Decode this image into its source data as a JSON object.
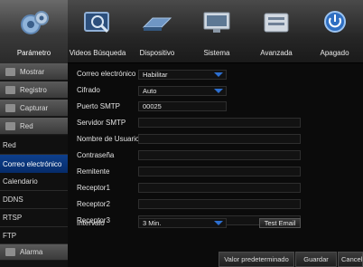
{
  "tabs": [
    {
      "label": "Parámetro",
      "icon": "gears-icon"
    },
    {
      "label": "Videos Búsqueda",
      "icon": "search-video-icon"
    },
    {
      "label": "Dispositivo",
      "icon": "hard-drive-icon"
    },
    {
      "label": "Sistema",
      "icon": "monitor-icon"
    },
    {
      "label": "Avanzada",
      "icon": "advanced-settings-icon"
    },
    {
      "label": "Apagado",
      "icon": "power-icon"
    }
  ],
  "sidebar": {
    "groups": [
      {
        "label": "Mostrar",
        "icon": "display-icon"
      },
      {
        "label": "Registro",
        "icon": "record-icon"
      },
      {
        "label": "Capturar",
        "icon": "capture-icon"
      },
      {
        "label": "Red",
        "icon": "network-icon"
      },
      {
        "label": "Alarma",
        "icon": "alarm-icon"
      }
    ],
    "subitems": [
      "Red",
      "Correo electrónico",
      "Calendario",
      "DDNS",
      "RTSP",
      "FTP"
    ]
  },
  "form": {
    "email_label": "Correo electrónico",
    "email_value": "Habilitar",
    "cipher_label": "Cifrado",
    "cipher_value": "Auto",
    "port_label": "Puerto SMTP",
    "port_value": "00025",
    "server_label": "Servidor SMTP",
    "server_value": "",
    "username_label": "Nombre de Usuario",
    "username_value": "",
    "password_label": "Contraseña",
    "password_value": "",
    "sender_label": "Remitente",
    "sender_value": "",
    "receiver1_label": "Receptor1",
    "receiver1_value": "",
    "receiver2_label": "Receptor2",
    "receiver2_value": "",
    "receiver3_label": "Receptor3",
    "receiver3_value": "",
    "interval_label": "Intervalo",
    "interval_value": "3 Min.",
    "test_email_label": "Test Email"
  },
  "footer": {
    "default_label": "Valor predeterminado",
    "save_label": "Guardar",
    "cancel_label": "Cancelar"
  },
  "colors": {
    "accent": "#2d6fd0",
    "active_sidebar": "#0e3f8c"
  }
}
